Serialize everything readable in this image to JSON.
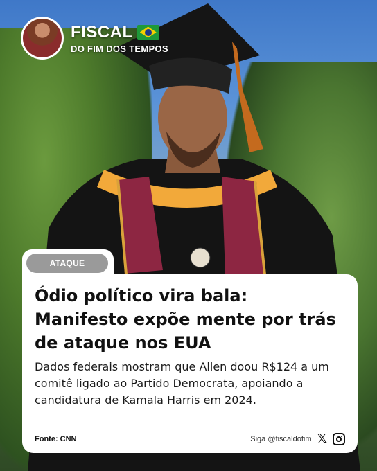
{
  "header": {
    "brand_title": "FISCAL",
    "brand_subtitle": "DO FIM DOS TEMPOS",
    "flag_icon": "brazil-flag-icon"
  },
  "card": {
    "tag": "ATAQUE",
    "headline_lines": [
      "Ódio político vira bala:",
      "Manifesto expõe mente por trás",
      "de ataque nos EUA"
    ],
    "body": "Dados federais mostram que Allen doou R$124 a um comitê ligado ao Partido Democrata, apoiando a candidatura de Kamala Harris em 2024.",
    "source": "Fonte: CNN",
    "follow": "Siga @fiscaldofim",
    "social_icons": [
      "x-icon",
      "instagram-icon"
    ]
  },
  "colors": {
    "tag_bg": "#9a9a9a",
    "card_bg": "#ffffff",
    "flag_green": "#1e9a3a",
    "flag_yellow": "#f5d000",
    "flag_blue": "#1d3a8a"
  }
}
